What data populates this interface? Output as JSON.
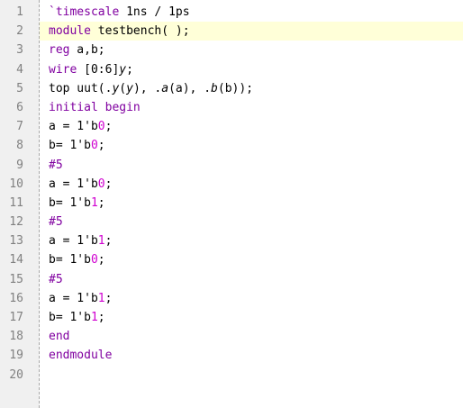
{
  "editor": {
    "current_line": 2,
    "colors": {
      "keyword": "#8000a0",
      "number": "#d000d0",
      "plain": "#000000",
      "gutter_bg": "#f0f0f0",
      "current_line_bg": "#ffffd8"
    },
    "lines": [
      {
        "number": "1",
        "tokens": [
          {
            "t": "kw",
            "v": "`timescale"
          },
          {
            "t": "plain",
            "v": " 1ns / 1ps"
          }
        ]
      },
      {
        "number": "2",
        "tokens": [
          {
            "t": "kw",
            "v": "module"
          },
          {
            "t": "plain",
            "v": " testbench( );"
          }
        ]
      },
      {
        "number": "3",
        "tokens": [
          {
            "t": "kw",
            "v": "reg"
          },
          {
            "t": "plain",
            "v": " a,b;"
          }
        ]
      },
      {
        "number": "4",
        "tokens": [
          {
            "t": "kw",
            "v": "wire"
          },
          {
            "t": "plain",
            "v": " [0:6]"
          },
          {
            "t": "italic",
            "v": "y"
          },
          {
            "t": "plain",
            "v": ";"
          }
        ]
      },
      {
        "number": "5",
        "tokens": [
          {
            "t": "plain",
            "v": "top uut(."
          },
          {
            "t": "italic",
            "v": "y"
          },
          {
            "t": "plain",
            "v": "("
          },
          {
            "t": "italic",
            "v": "y"
          },
          {
            "t": "plain",
            "v": "), ."
          },
          {
            "t": "italic",
            "v": "a"
          },
          {
            "t": "plain",
            "v": "(a), ."
          },
          {
            "t": "italic",
            "v": "b"
          },
          {
            "t": "plain",
            "v": "(b));"
          }
        ]
      },
      {
        "number": "6",
        "tokens": [
          {
            "t": "kw",
            "v": "initial begin"
          }
        ]
      },
      {
        "number": "7",
        "tokens": [
          {
            "t": "plain",
            "v": "a = 1'b"
          },
          {
            "t": "num",
            "v": "0"
          },
          {
            "t": "plain",
            "v": ";"
          }
        ]
      },
      {
        "number": "8",
        "tokens": [
          {
            "t": "plain",
            "v": "b= 1'b"
          },
          {
            "t": "num",
            "v": "0"
          },
          {
            "t": "plain",
            "v": ";"
          }
        ]
      },
      {
        "number": "9",
        "tokens": [
          {
            "t": "kw",
            "v": "#5"
          }
        ]
      },
      {
        "number": "10",
        "tokens": [
          {
            "t": "plain",
            "v": "a = 1'b"
          },
          {
            "t": "num",
            "v": "0"
          },
          {
            "t": "plain",
            "v": ";"
          }
        ]
      },
      {
        "number": "11",
        "tokens": [
          {
            "t": "plain",
            "v": "b= 1'b"
          },
          {
            "t": "num",
            "v": "1"
          },
          {
            "t": "plain",
            "v": ";"
          }
        ]
      },
      {
        "number": "12",
        "tokens": [
          {
            "t": "kw",
            "v": "#5"
          }
        ]
      },
      {
        "number": "13",
        "tokens": [
          {
            "t": "plain",
            "v": "a = 1'b"
          },
          {
            "t": "num",
            "v": "1"
          },
          {
            "t": "plain",
            "v": ";"
          }
        ]
      },
      {
        "number": "14",
        "tokens": [
          {
            "t": "plain",
            "v": "b= 1'b"
          },
          {
            "t": "num",
            "v": "0"
          },
          {
            "t": "plain",
            "v": ";"
          }
        ]
      },
      {
        "number": "15",
        "tokens": [
          {
            "t": "kw",
            "v": "#5"
          }
        ]
      },
      {
        "number": "16",
        "tokens": [
          {
            "t": "plain",
            "v": "a = 1'b"
          },
          {
            "t": "num",
            "v": "1"
          },
          {
            "t": "plain",
            "v": ";"
          }
        ]
      },
      {
        "number": "17",
        "tokens": [
          {
            "t": "plain",
            "v": "b= 1'b"
          },
          {
            "t": "num",
            "v": "1"
          },
          {
            "t": "plain",
            "v": ";"
          }
        ]
      },
      {
        "number": "18",
        "tokens": [
          {
            "t": "kw",
            "v": "end"
          }
        ]
      },
      {
        "number": "19",
        "tokens": [
          {
            "t": "kw",
            "v": "endmodule"
          }
        ]
      },
      {
        "number": "20",
        "tokens": []
      }
    ]
  }
}
